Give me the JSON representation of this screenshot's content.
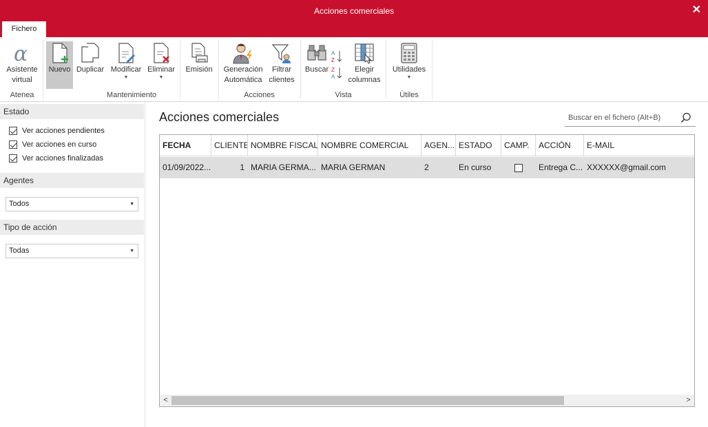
{
  "window": {
    "title": "Acciones comerciales",
    "close_label": "✕"
  },
  "tabs": [
    {
      "label": "Fichero"
    }
  ],
  "ribbon": {
    "buttons": {
      "asistente": "Asistente virtual",
      "nuevo": "Nuevo",
      "duplicar": "Duplicar",
      "modificar": "Modificar",
      "eliminar": "Eliminar",
      "emision": "Emisión",
      "generacion": "Generación Automática",
      "filtrar": "Filtrar clientes",
      "buscar": "Buscar",
      "elegir": "Elegir columnas",
      "utilidades": "Utilidades"
    },
    "groups": {
      "atenea": "Atenea",
      "mantenimiento": "Mantenimiento",
      "acciones": "Acciones",
      "vista": "Vista",
      "utiles": "Útiles"
    },
    "accent_color": "#c8102e"
  },
  "sidebar": {
    "estado": {
      "title": "Estado",
      "options": [
        {
          "label": "Ver acciones pendientes",
          "checked": true
        },
        {
          "label": "Ver acciones en curso",
          "checked": true
        },
        {
          "label": "Ver acciones finalizadas",
          "checked": true
        }
      ]
    },
    "agentes": {
      "title": "Agentes",
      "selected": "Todos"
    },
    "tipo_accion": {
      "title": "Tipo de acción",
      "selected": "Todas"
    }
  },
  "main": {
    "title": "Acciones comerciales",
    "search_placeholder": "Buscar en el fichero (Alt+B)",
    "columns": [
      "FECHA",
      "CLIENTE",
      "NOMBRE FISCAL",
      "NOMBRE COMERCIAL",
      "AGEN...",
      "ESTADO",
      "CAMP.",
      "ACCIÓN",
      "E-MAIL"
    ],
    "rows": [
      {
        "fecha": "01/09/2022...",
        "cliente": "1",
        "nombre_fiscal": "MARIA GERMA...",
        "nombre_comercial": "MARIA GERMAN",
        "agente": "2",
        "estado": "En curso",
        "campana": false,
        "accion": "Entrega C...",
        "email": "XXXXXX@gmail.com"
      }
    ]
  }
}
